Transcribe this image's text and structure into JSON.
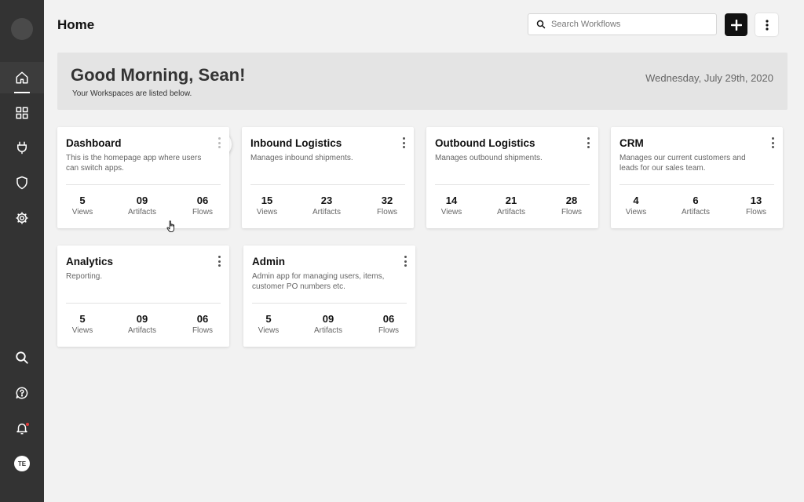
{
  "header": {
    "title": "Home",
    "search_placeholder": "Search Workflows"
  },
  "banner": {
    "greeting": "Good Morning, Sean!",
    "subtitle": "Your Workspaces are listed below.",
    "date": "Wednesday, July 29th, 2020"
  },
  "sidebar": {
    "items": [
      {
        "icon": "home-icon",
        "active": true
      },
      {
        "icon": "apps-grid-icon"
      },
      {
        "icon": "plug-icon"
      },
      {
        "icon": "shield-icon"
      },
      {
        "icon": "gear-icon"
      }
    ],
    "bottom": [
      {
        "icon": "search-icon"
      },
      {
        "icon": "help-icon"
      },
      {
        "icon": "bell-icon"
      }
    ],
    "avatar_initials": "TE"
  },
  "cards": [
    {
      "title": "Dashboard",
      "desc": "This is the homepage app where users can switch apps.",
      "views": "5",
      "artifacts": "09",
      "flows": "06"
    },
    {
      "title": "Inbound Logistics",
      "desc": "Manages inbound shipments.",
      "views": "15",
      "artifacts": "23",
      "flows": "32"
    },
    {
      "title": "Outbound Logistics",
      "desc": "Manages outbound shipments.",
      "views": "14",
      "artifacts": "21",
      "flows": "28"
    },
    {
      "title": "CRM",
      "desc": "Manages our current customers and leads for our sales team.",
      "views": "4",
      "artifacts": "6",
      "flows": "13"
    },
    {
      "title": "Analytics",
      "desc": "Reporting.",
      "views": "5",
      "artifacts": "09",
      "flows": "06"
    },
    {
      "title": "Admin",
      "desc": "Admin app for managing users, items, customer PO numbers etc.",
      "views": "5",
      "artifacts": "09",
      "flows": "06"
    }
  ],
  "stat_labels": {
    "views": "Views",
    "artifacts": "Artifacts",
    "flows": "Flows"
  }
}
